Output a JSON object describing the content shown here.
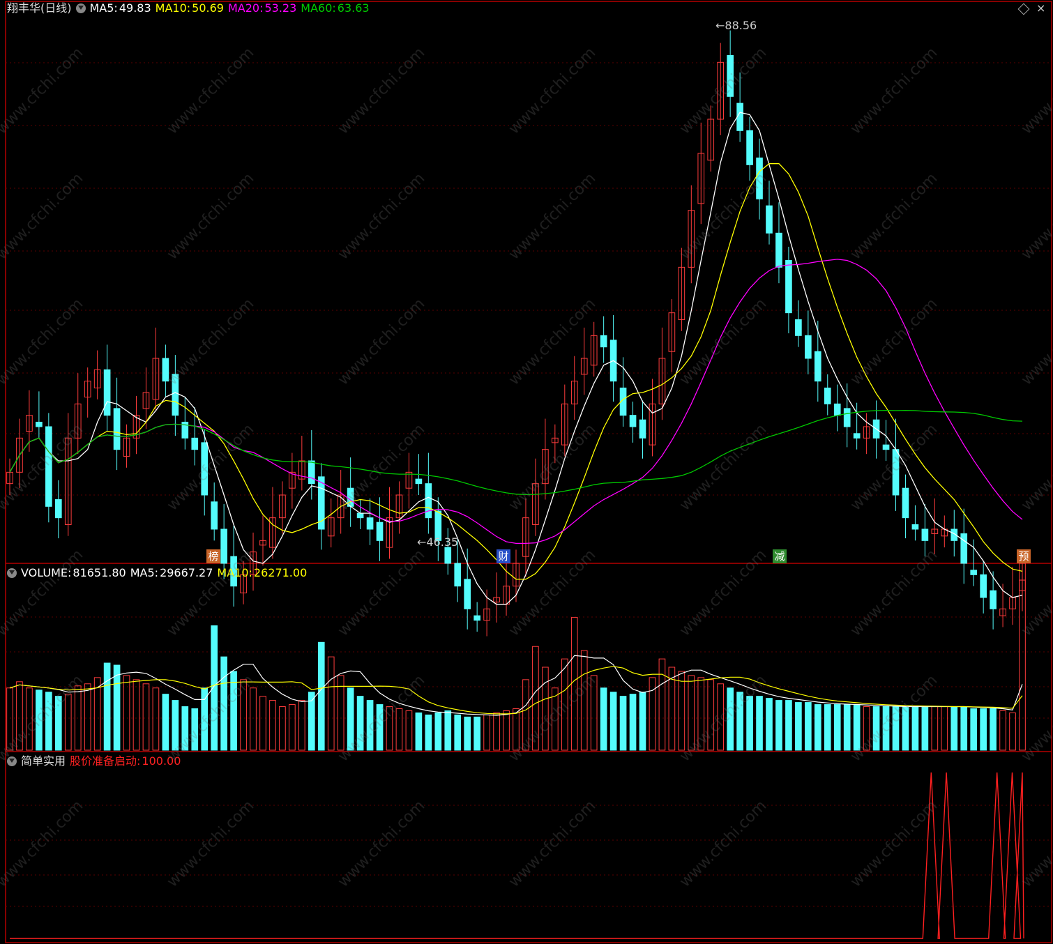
{
  "stock": {
    "name": "翔丰华(日线)",
    "ma5_label": "MA5:",
    "ma5": "49.83",
    "ma10_label": "MA10:",
    "ma10": "50.69",
    "ma20_label": "MA20:",
    "ma20": "53.23",
    "ma60_label": "MA60:",
    "ma60": "63.63"
  },
  "volume_panel": {
    "label": "VOLUME:",
    "value": "81651.80",
    "ma5_label": "MA5:",
    "ma5": "29667.27",
    "ma10_label": "MA10:",
    "ma10": "26271.00"
  },
  "indicator_panel": {
    "name": "简单实用",
    "signal_label": "股价准备启动:",
    "signal_value": "100.00"
  },
  "annotations": {
    "high": "88.56",
    "low": "46.35"
  },
  "event_tags": [
    {
      "text": "榜",
      "color": "#c86428"
    },
    {
      "text": "财",
      "color": "#2850c8"
    },
    {
      "text": "减",
      "color": "#2e8b2e"
    },
    {
      "text": "预",
      "color": "#c86428"
    }
  ],
  "watermark": "www.cfchi.com",
  "colors": {
    "up": "#ff3c3c",
    "down": "#54fcfc",
    "ma5": "#ffffff",
    "ma10": "#ffff00",
    "ma20": "#ff00ff",
    "ma60": "#00c800",
    "frame": "#b40000",
    "signal": "#ff2020"
  },
  "chart_data": {
    "type": "candlestick",
    "price_range": [
      44,
      92
    ],
    "closes": [
      52,
      55,
      57,
      56,
      49,
      48,
      55,
      58,
      60,
      61,
      57,
      54,
      55,
      57,
      59,
      62,
      60,
      57,
      55,
      54,
      50,
      47,
      44,
      42,
      43,
      45,
      46,
      48,
      50,
      52,
      53,
      51,
      47,
      48,
      50,
      49,
      48,
      47,
      46,
      48,
      50,
      52,
      51,
      48,
      46,
      44,
      42,
      40,
      39,
      40,
      41,
      42,
      44,
      48,
      51,
      54,
      55,
      58,
      60,
      62,
      64,
      63,
      60,
      57,
      56,
      55,
      58,
      62,
      66,
      70,
      75,
      80,
      83,
      88,
      85,
      82,
      79,
      76,
      73,
      70,
      66,
      64,
      62,
      60,
      58,
      57,
      56,
      55,
      56,
      55,
      54,
      50,
      48,
      47,
      46,
      47,
      47,
      46,
      44,
      43,
      41,
      40,
      40,
      41,
      44
    ],
    "volume_max": 80000,
    "volumes": [
      30000,
      33000,
      30000,
      29000,
      28000,
      26000,
      27000,
      31000,
      32000,
      35000,
      42000,
      41000,
      36000,
      34000,
      32000,
      30000,
      27000,
      24000,
      21000,
      20000,
      30000,
      60000,
      45000,
      38000,
      34000,
      30000,
      26000,
      24000,
      21000,
      22000,
      24000,
      28000,
      52000,
      45000,
      36000,
      30000,
      26000,
      24000,
      22000,
      21000,
      20000,
      19000,
      18000,
      17000,
      18000,
      19000,
      17000,
      16000,
      16000,
      17000,
      18000,
      19000,
      20000,
      34000,
      50000,
      40000,
      30000,
      44000,
      64000,
      48000,
      36000,
      30000,
      28000,
      26000,
      27000,
      28000,
      35000,
      44000,
      40000,
      38000,
      36000,
      35000,
      34000,
      32000,
      30000,
      28000,
      26000,
      26000,
      25000,
      24000,
      24000,
      23000,
      23000,
      22000,
      22000,
      22000,
      22000,
      22000,
      21000,
      21000,
      21000,
      21000,
      21000,
      21000,
      21000,
      21000,
      21000,
      21000,
      21000,
      20000,
      20000,
      20000,
      19000,
      18000,
      82000
    ],
    "signal_range": [
      0,
      100
    ],
    "signal_peaks_at_index_fraction": [
      0.91,
      0.925,
      0.975,
      0.99,
      1.0
    ]
  }
}
